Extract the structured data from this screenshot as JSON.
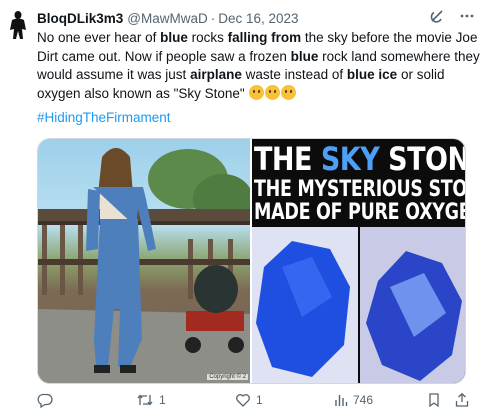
{
  "tweet": {
    "author_name": "BloqDLik3m3",
    "handle": "@MawMwaD",
    "separator": "·",
    "date": "Dec 16, 2023",
    "text_parts": [
      {
        "t": "No one ever hear of ",
        "b": false
      },
      {
        "t": "blue",
        "b": true
      },
      {
        "t": " rocks ",
        "b": false
      },
      {
        "t": "falling from",
        "b": true
      },
      {
        "t": " the sky before the movie Joe Dirt came out. Now if people saw a frozen ",
        "b": false
      },
      {
        "t": "blue",
        "b": true
      },
      {
        "t": " rock land somewhere they would assume it was just ",
        "b": false
      },
      {
        "t": "airplane",
        "b": true
      },
      {
        "t": " waste instead of ",
        "b": false
      },
      {
        "t": "blue ice",
        "b": true
      },
      {
        "t": " or solid oxygen also known as \"Sky Stone\" ",
        "b": false
      }
    ],
    "emojis": [
      "face-with-monocle",
      "thinking-face",
      "shushing-face"
    ],
    "hashtag": "#HidingTheFirmament"
  },
  "media": {
    "left_copyright": "Copyright © 2",
    "title_part1": "THE ",
    "title_sky": "SKY",
    "title_part2": " STONE",
    "subtitle_line1": "THE MYSTERIOUS STONE",
    "subtitle_line2": "MADE OF PURE OXYGEN",
    "colors": {
      "sky_word": "#4ea0f6",
      "rock_blue": "#1f4fe0"
    }
  },
  "actions": {
    "reply_count": "",
    "retweet_count": "1",
    "like_count": "1",
    "views_count": "746"
  },
  "icons": [
    "avatar",
    "grok-icon",
    "more-icon",
    "reply-icon",
    "retweet-icon",
    "like-icon",
    "views-icon",
    "bookmark-icon",
    "share-icon"
  ]
}
